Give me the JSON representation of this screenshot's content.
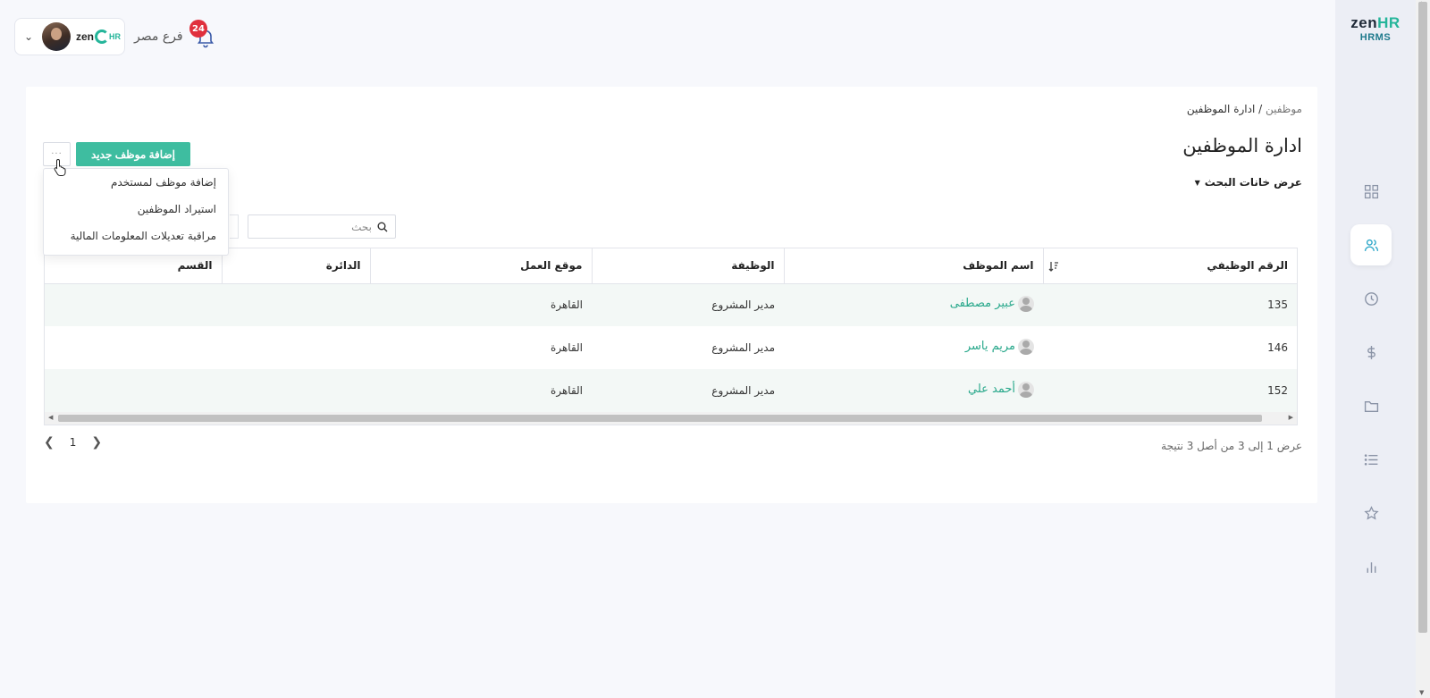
{
  "sidebar": {
    "brand_main": "zen",
    "brand_hr": "HR",
    "brand_sub": "HRMS",
    "items": [
      {
        "icon": "dashboard-icon"
      },
      {
        "icon": "users-icon",
        "active": true
      },
      {
        "icon": "clock-icon"
      },
      {
        "icon": "dollar-icon"
      },
      {
        "icon": "folder-icon"
      },
      {
        "icon": "list-icon"
      },
      {
        "icon": "star-icon"
      },
      {
        "icon": "bar-chart-icon"
      }
    ]
  },
  "topbar": {
    "branch": "فرع مصر",
    "notifications_count": "24",
    "company_logo_main": "zen",
    "company_logo_hr": "HR"
  },
  "breadcrumb": {
    "parent": "موظفين",
    "separator": " / ",
    "current": "ادارة الموظفين"
  },
  "page": {
    "title": "ادارة الموظفين",
    "search_toggle": "عرض خانات البحث",
    "add_button": "إضافة موظف جديد",
    "more_button": "···",
    "search_placeholder": "بحث"
  },
  "dropdown": {
    "items": [
      "إضافة موظف لمستخدم",
      "استيراد الموظفين",
      "مراقبة تعديلات المعلومات المالية"
    ]
  },
  "table": {
    "headers": [
      "الرقم الوظيفي",
      "اسم الموظف",
      "الوظيفة",
      "موقع العمل",
      "الدائرة",
      "القسم"
    ],
    "rows": [
      {
        "id": "135",
        "name": "عبير مصطفى",
        "job": "مدير المشروع",
        "location": "القاهرة",
        "department": "",
        "section": ""
      },
      {
        "id": "146",
        "name": "مريم ياسر",
        "job": "مدير المشروع",
        "location": "القاهرة",
        "department": "",
        "section": ""
      },
      {
        "id": "152",
        "name": "أحمد علي",
        "job": "مدير المشروع",
        "location": "القاهرة",
        "department": "",
        "section": ""
      }
    ]
  },
  "pagination": {
    "current_page": "1",
    "result_info": "عرض 1 إلى 3 من أصل 3 نتيجة"
  },
  "colors": {
    "accent": "#3ebda0",
    "link": "#28a88b",
    "badge": "#e0303d"
  }
}
